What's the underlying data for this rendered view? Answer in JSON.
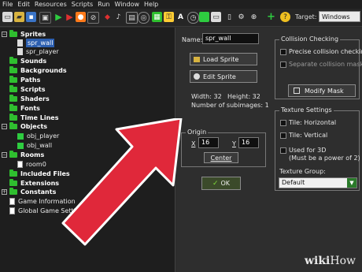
{
  "menu": [
    "File",
    "Edit",
    "Resources",
    "Scripts",
    "Run",
    "Window",
    "Help"
  ],
  "toolbar": {
    "target_label": "Target:",
    "target_value": "Windows"
  },
  "tree": {
    "items": [
      {
        "label": "Sprites",
        "bold": true
      },
      {
        "label": "spr_wall",
        "selected": true
      },
      {
        "label": "spr_player"
      },
      {
        "label": "Sounds",
        "bold": true
      },
      {
        "label": "Backgrounds",
        "bold": true
      },
      {
        "label": "Paths",
        "bold": true
      },
      {
        "label": "Scripts",
        "bold": true
      },
      {
        "label": "Shaders",
        "bold": true
      },
      {
        "label": "Fonts",
        "bold": true
      },
      {
        "label": "Time Lines",
        "bold": true
      },
      {
        "label": "Objects",
        "bold": true
      },
      {
        "label": "obj_player"
      },
      {
        "label": "obj_wall"
      },
      {
        "label": "Rooms",
        "bold": true
      },
      {
        "label": "room0"
      },
      {
        "label": "Included Files",
        "bold": true
      },
      {
        "label": "Extensions",
        "bold": true
      },
      {
        "label": "Constants",
        "bold": true
      },
      {
        "label": "Game Information"
      },
      {
        "label": "Global Game Settings"
      }
    ]
  },
  "sprite": {
    "name_label": "Name:",
    "name_value": "spr_wall",
    "load_sprite": "Load Sprite",
    "edit_sprite": "Edit Sprite",
    "width_text": "Width: 32",
    "height_text": "Height: 32",
    "subimages_text": "Number of subimages: 1",
    "origin_title": "Origin",
    "x_label": "X",
    "x_value": "16",
    "y_label": "Y",
    "y_value": "16",
    "center_button": "Center",
    "ok_button": "OK"
  },
  "collision": {
    "title": "Collision Checking",
    "precise": "Precise collision checking",
    "separate": "Separate collision masks",
    "modify_mask": "Modify Mask"
  },
  "texture": {
    "title": "Texture Settings",
    "tile_h": "Tile: Horizontal",
    "tile_v": "Tile: Vertical",
    "used_3d": "Used for 3D",
    "power2": "(Must be a power of 2)",
    "group_label": "Texture Group:",
    "group_value": "Default"
  },
  "watermark": {
    "wiki": "wiki",
    "how": "How"
  },
  "colors": {
    "arrow": "#e0283a",
    "selection": "#2c5fb0",
    "folder": "#2fbf2f"
  }
}
